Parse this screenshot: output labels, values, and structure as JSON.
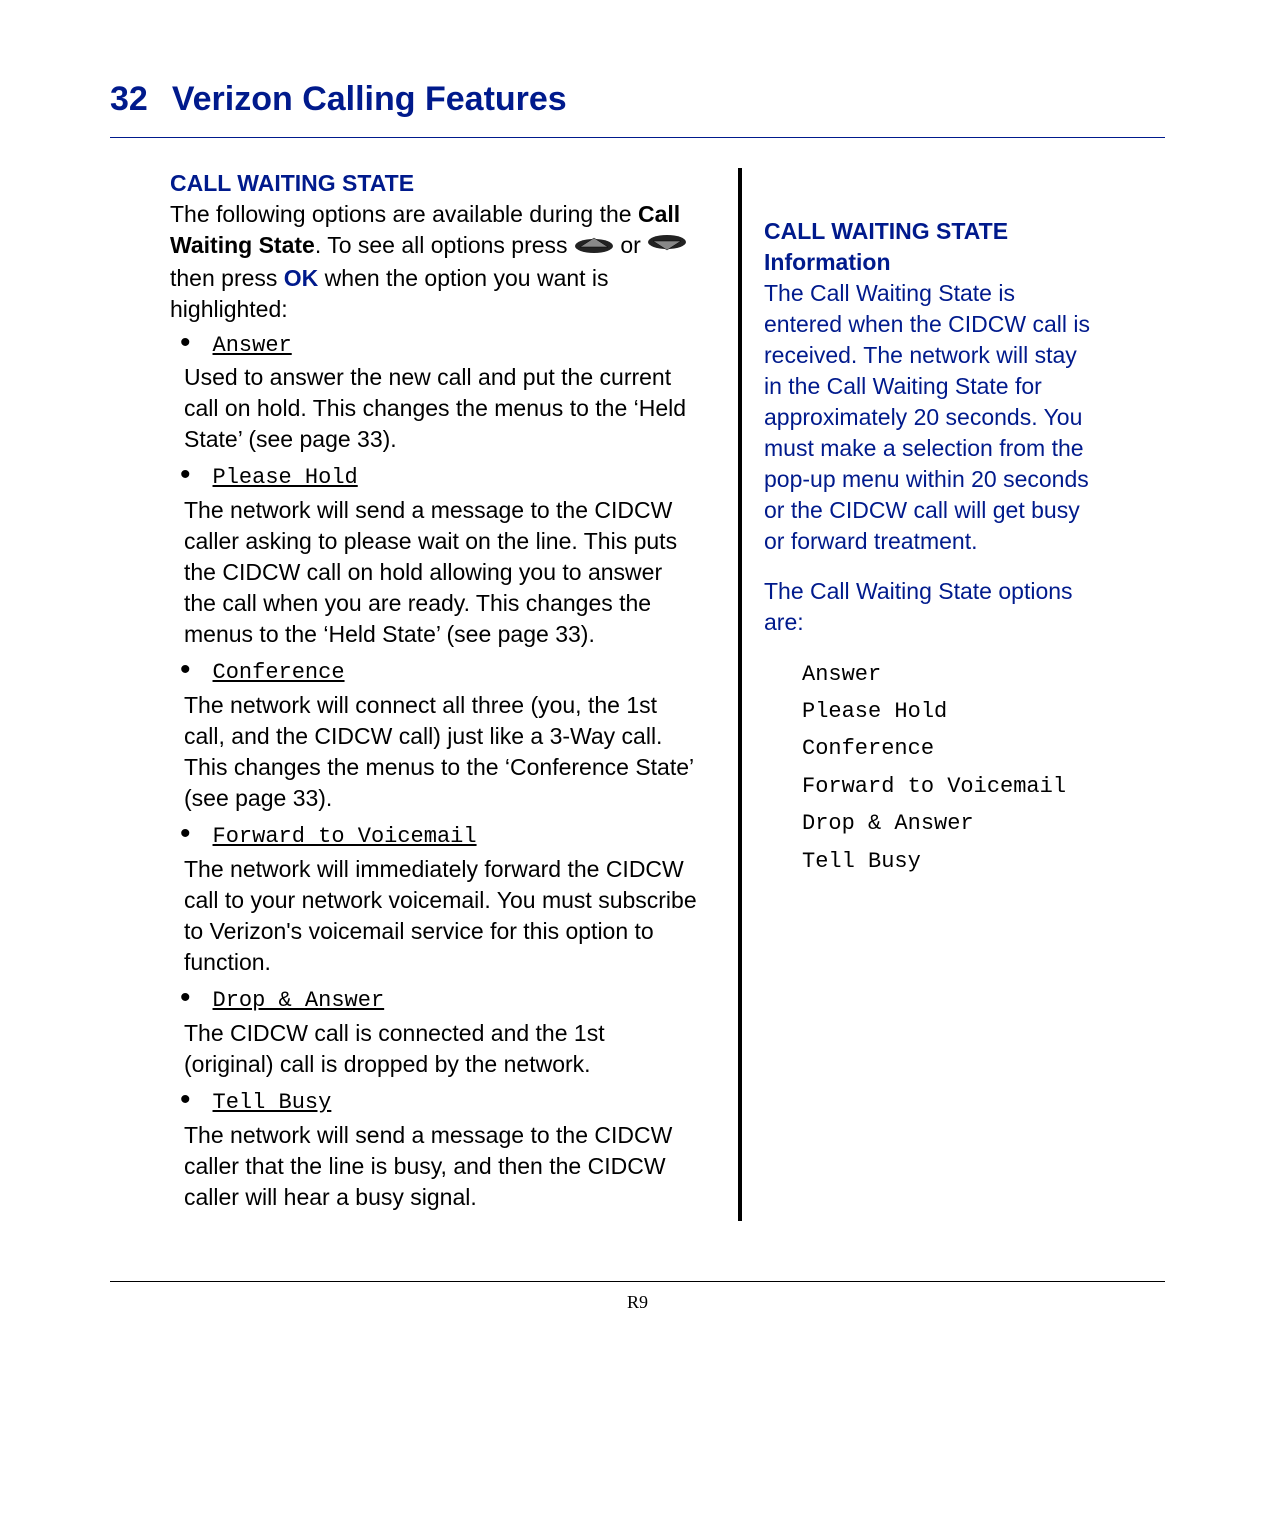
{
  "header": {
    "page_number": "32",
    "title": "Verizon Calling Features"
  },
  "main": {
    "section_heading": "CALL WAITING STATE",
    "intro_part1": "The following options are available during the ",
    "intro_bold": "Call Waiting State",
    "intro_part2": ".  To see all options press ",
    "intro_or": " or ",
    "intro_part3": " then press ",
    "intro_ok": "OK",
    "intro_part4": " when the option you want is highlighted:",
    "options": [
      {
        "label": "Answer",
        "desc": "Used to answer the new call and put the current call on hold.  This changes the menus to the ‘Held State’ (see page 33)."
      },
      {
        "label": "Please Hold",
        "desc": "The network will send a message to the CIDCW caller asking to please wait on the line.  This puts the CIDCW call on hold allowing you to answer the call when you are ready.  This changes the menus to the ‘Held State’ (see page 33)."
      },
      {
        "label": "Conference",
        "desc": "The network will connect all three (you, the 1st call, and the CIDCW call) just like a 3-Way call.  This changes the menus to the ‘Conference State’ (see page 33)."
      },
      {
        "label": "Forward to Voicemail",
        "desc": "The network will immediately forward the CIDCW call to your network voicemail.  You must subscribe to Verizon's voicemail service for this option to function."
      },
      {
        "label": "Drop & Answer",
        "desc": "The CIDCW call is connected and the 1st (original) call is dropped by the network."
      },
      {
        "label": "Tell Busy",
        "desc": "The network will send a message to the CIDCW caller that the line is busy, and then the CIDCW caller will hear a busy signal."
      }
    ]
  },
  "sidebar": {
    "heading": "CALL WAITING STATE Information",
    "para1": "The Call Waiting State is entered when the CIDCW call is received.  The network will stay in the Call Waiting State for approximately 20 seconds.  You must make a selection from the pop-up menu within 20 seconds or the CIDCW call will get busy or forward treatment.",
    "para2": "The Call Waiting State options are:",
    "options": [
      "Answer",
      "Please Hold",
      "Conference",
      "Forward to Voicemail",
      "Drop & Answer",
      "Tell Busy"
    ]
  },
  "footer": {
    "label": "R9"
  }
}
